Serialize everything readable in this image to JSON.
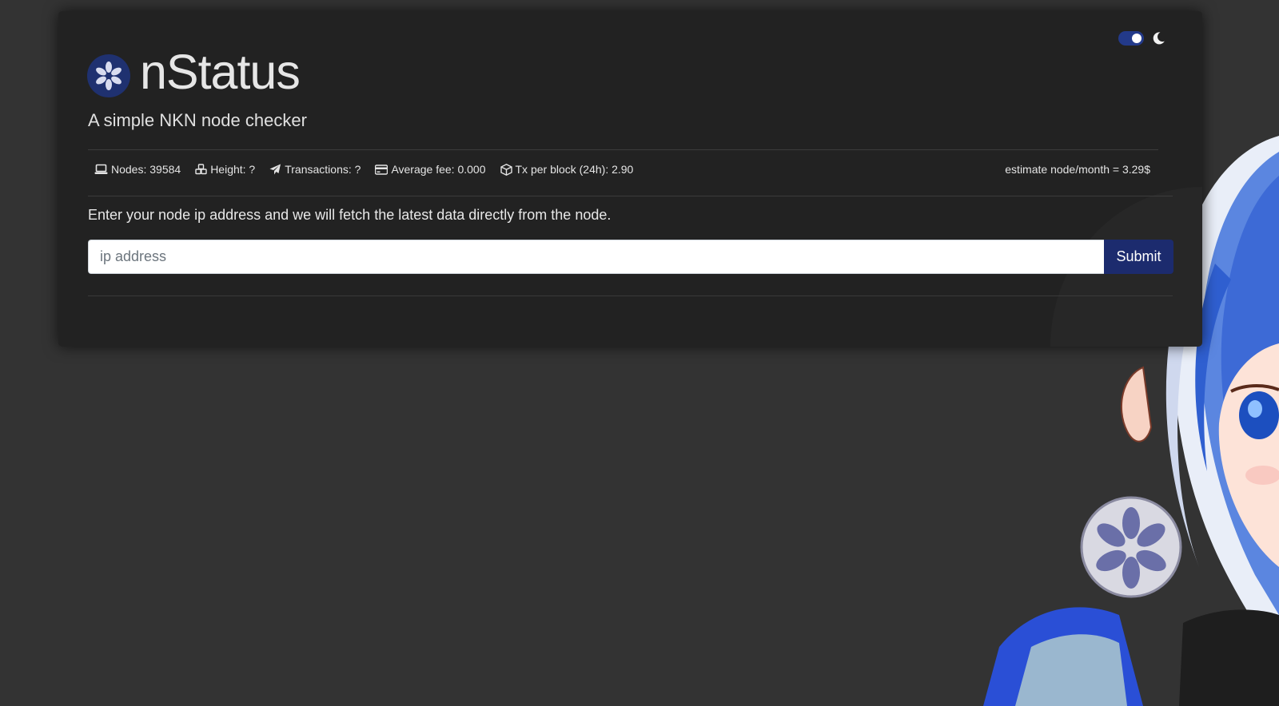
{
  "header": {
    "title": "nStatus",
    "subtitle": "A simple NKN node checker",
    "logo_icon": "nkn-flower-icon",
    "theme_toggle_state": "dark",
    "moon_icon": "moon-icon"
  },
  "stats": {
    "nodes": "Nodes: 39584",
    "height": "Height: ?",
    "transactions": "Transactions: ?",
    "average_fee": "Average fee: 0.000",
    "tx_per_block": "Tx per block (24h): 2.90",
    "estimate": "estimate node/month = 3.29$"
  },
  "form": {
    "instructions": "Enter your node ip address and we will fetch the latest data directly from the node.",
    "placeholder": "ip address",
    "value": "",
    "submit_label": "Submit"
  },
  "colors": {
    "page_background": "#333333",
    "card_background": "#222222",
    "accent": "#1c2b6e",
    "toggle": "#233a8a",
    "text": "#e6e6e6"
  }
}
